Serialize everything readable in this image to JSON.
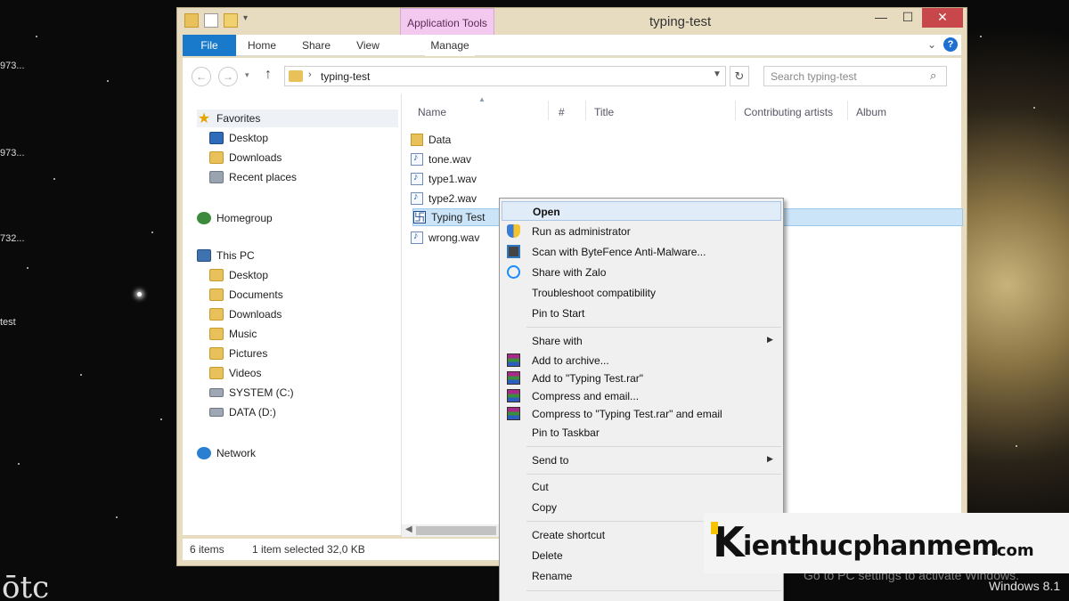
{
  "desktop": {
    "labels": [
      "973...",
      "973...",
      "732...",
      "test"
    ],
    "glyph": "ōtc",
    "activate_notice": "Go to PC settings to activate Windows.",
    "os_version": "Windows 8.1"
  },
  "window": {
    "title": "typing-test",
    "context_group": "Application Tools",
    "ribbon_tabs": {
      "file": "File",
      "home": "Home",
      "share": "Share",
      "view": "View",
      "manage": "Manage"
    },
    "controls": {
      "minimize": "—",
      "maximize": "☐",
      "close": "✕"
    },
    "help": "?"
  },
  "address": {
    "path": "typing-test",
    "separator": "›",
    "search_placeholder": "Search typing-test"
  },
  "nav_pane": {
    "favorites": "Favorites",
    "favorites_items": [
      "Desktop",
      "Downloads",
      "Recent places"
    ],
    "homegroup": "Homegroup",
    "this_pc": "This PC",
    "pc_items": [
      "Desktop",
      "Documents",
      "Downloads",
      "Music",
      "Pictures",
      "Videos",
      "SYSTEM (C:)",
      "DATA (D:)"
    ],
    "network": "Network"
  },
  "columns": {
    "name": "Name",
    "number": "#",
    "title": "Title",
    "artists": "Contributing artists",
    "album": "Album"
  },
  "files": [
    "Data",
    "tone.wav",
    "type1.wav",
    "type2.wav",
    "Typing Test",
    "wrong.wav"
  ],
  "status": {
    "items": "6 items",
    "selection": "1 item selected  32,0 KB"
  },
  "context_menu": {
    "open": "Open",
    "run_admin": "Run as administrator",
    "scan": "Scan with ByteFence Anti-Malware...",
    "share_zalo": "Share with Zalo",
    "troubleshoot": "Troubleshoot compatibility",
    "pin_start": "Pin to Start",
    "share_with": "Share with",
    "add_archive": "Add to archive...",
    "add_rar": "Add to \"Typing Test.rar\"",
    "compress_email": "Compress and email...",
    "compress_rar_email": "Compress to \"Typing Test.rar\" and email",
    "pin_taskbar": "Pin to Taskbar",
    "send_to": "Send to",
    "cut": "Cut",
    "copy": "Copy",
    "create_shortcut": "Create shortcut",
    "delete": "Delete",
    "rename": "Rename"
  },
  "watermark": {
    "letter": "K",
    "name": "ienthucphanmem",
    "tld": ".com"
  }
}
